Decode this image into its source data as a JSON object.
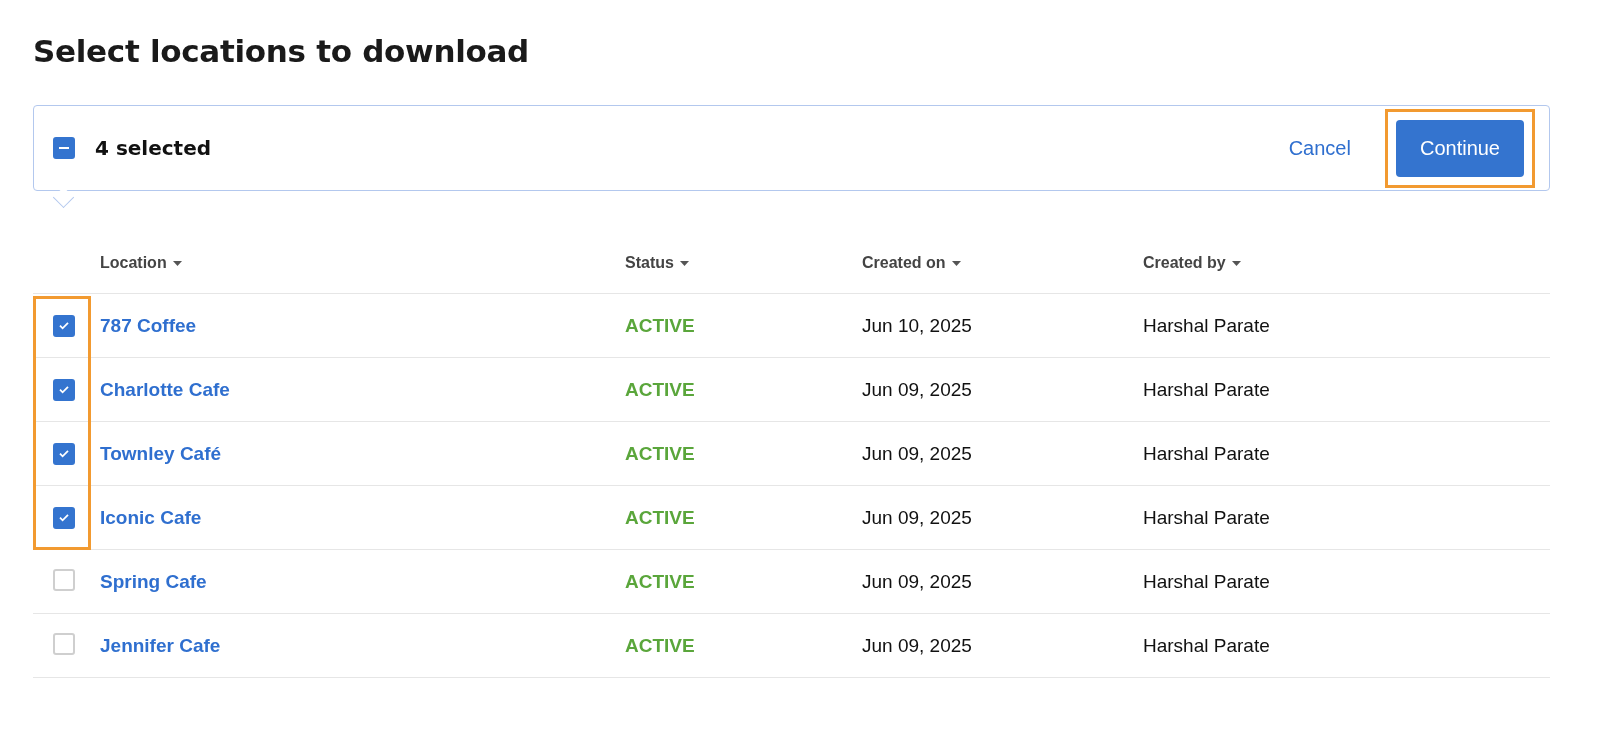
{
  "title": "Select locations to download",
  "selection_bar": {
    "select_all": {
      "checked": true,
      "indeterminate": true
    },
    "count_label": "4 selected",
    "cancel": "Cancel",
    "continue": {
      "label": "Continue",
      "highlighted": true
    }
  },
  "table": {
    "columns": [
      "Location",
      "Status",
      "Created on",
      "Created by"
    ],
    "rows": [
      {
        "location": "787 Coffee",
        "status": "ACTIVE",
        "created_on": "Jun 10, 2025",
        "created_by": "Harshal Parate",
        "checked": true,
        "highlighted": true
      },
      {
        "location": "Charlotte Cafe",
        "status": "ACTIVE",
        "created_on": "Jun 09, 2025",
        "created_by": "Harshal Parate",
        "checked": true,
        "highlighted": true
      },
      {
        "location": "Townley Café",
        "status": "ACTIVE",
        "created_on": "Jun 09, 2025",
        "created_by": "Harshal Parate",
        "checked": true,
        "highlighted": true
      },
      {
        "location": "Iconic Cafe",
        "status": "ACTIVE",
        "created_on": "Jun 09, 2025",
        "created_by": "Harshal Parate",
        "checked": true,
        "highlighted": true
      },
      {
        "location": "Spring Cafe",
        "status": "ACTIVE",
        "created_on": "Jun 09, 2025",
        "created_by": "Harshal Parate",
        "checked": false,
        "highlighted": false
      },
      {
        "location": "Jennifer Cafe",
        "status": "ACTIVE",
        "created_on": "Jun 09, 2025",
        "created_by": "Harshal Parate",
        "checked": false,
        "highlighted": false
      }
    ]
  }
}
